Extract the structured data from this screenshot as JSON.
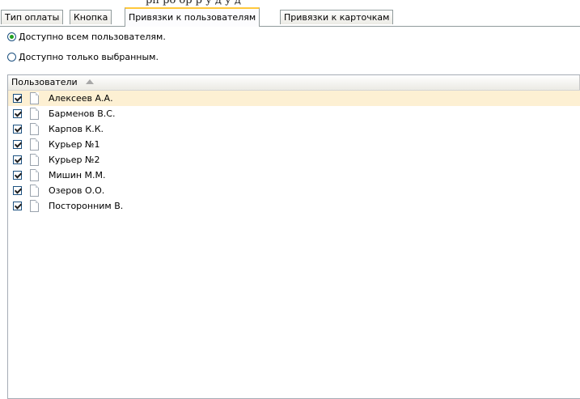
{
  "window": {
    "cut_title": "рп ро ор р у д у д"
  },
  "tabs": [
    {
      "label": "Тип оплаты",
      "active": false
    },
    {
      "label": "Кнопка",
      "active": false
    },
    {
      "label": "Привязки к пользователям",
      "active": true
    },
    {
      "label": "Привязки к карточкам",
      "active": false
    }
  ],
  "access": {
    "all_users_label": "Доступно всем пользователям.",
    "selected_only_label": "Доступно только выбранным.",
    "selected_option": "all_users"
  },
  "users_list": {
    "column_header": "Пользователи",
    "sort": "ascending",
    "rows": [
      {
        "name": "Алексеев А.А.",
        "checked": true,
        "selected": true
      },
      {
        "name": "Барменов В.С.",
        "checked": true,
        "selected": false
      },
      {
        "name": "Карпов К.К.",
        "checked": true,
        "selected": false
      },
      {
        "name": "Курьер №1",
        "checked": true,
        "selected": false
      },
      {
        "name": "Курьер №2",
        "checked": true,
        "selected": false
      },
      {
        "name": "Мишин М.М.",
        "checked": true,
        "selected": false
      },
      {
        "name": "Озеров О.О.",
        "checked": true,
        "selected": false
      },
      {
        "name": "Посторонним В.",
        "checked": true,
        "selected": false
      }
    ]
  },
  "colors": {
    "active_tab_accent": "#ffc83c",
    "selected_row": "#fdf0d3",
    "radio_dot": "#21a121"
  }
}
